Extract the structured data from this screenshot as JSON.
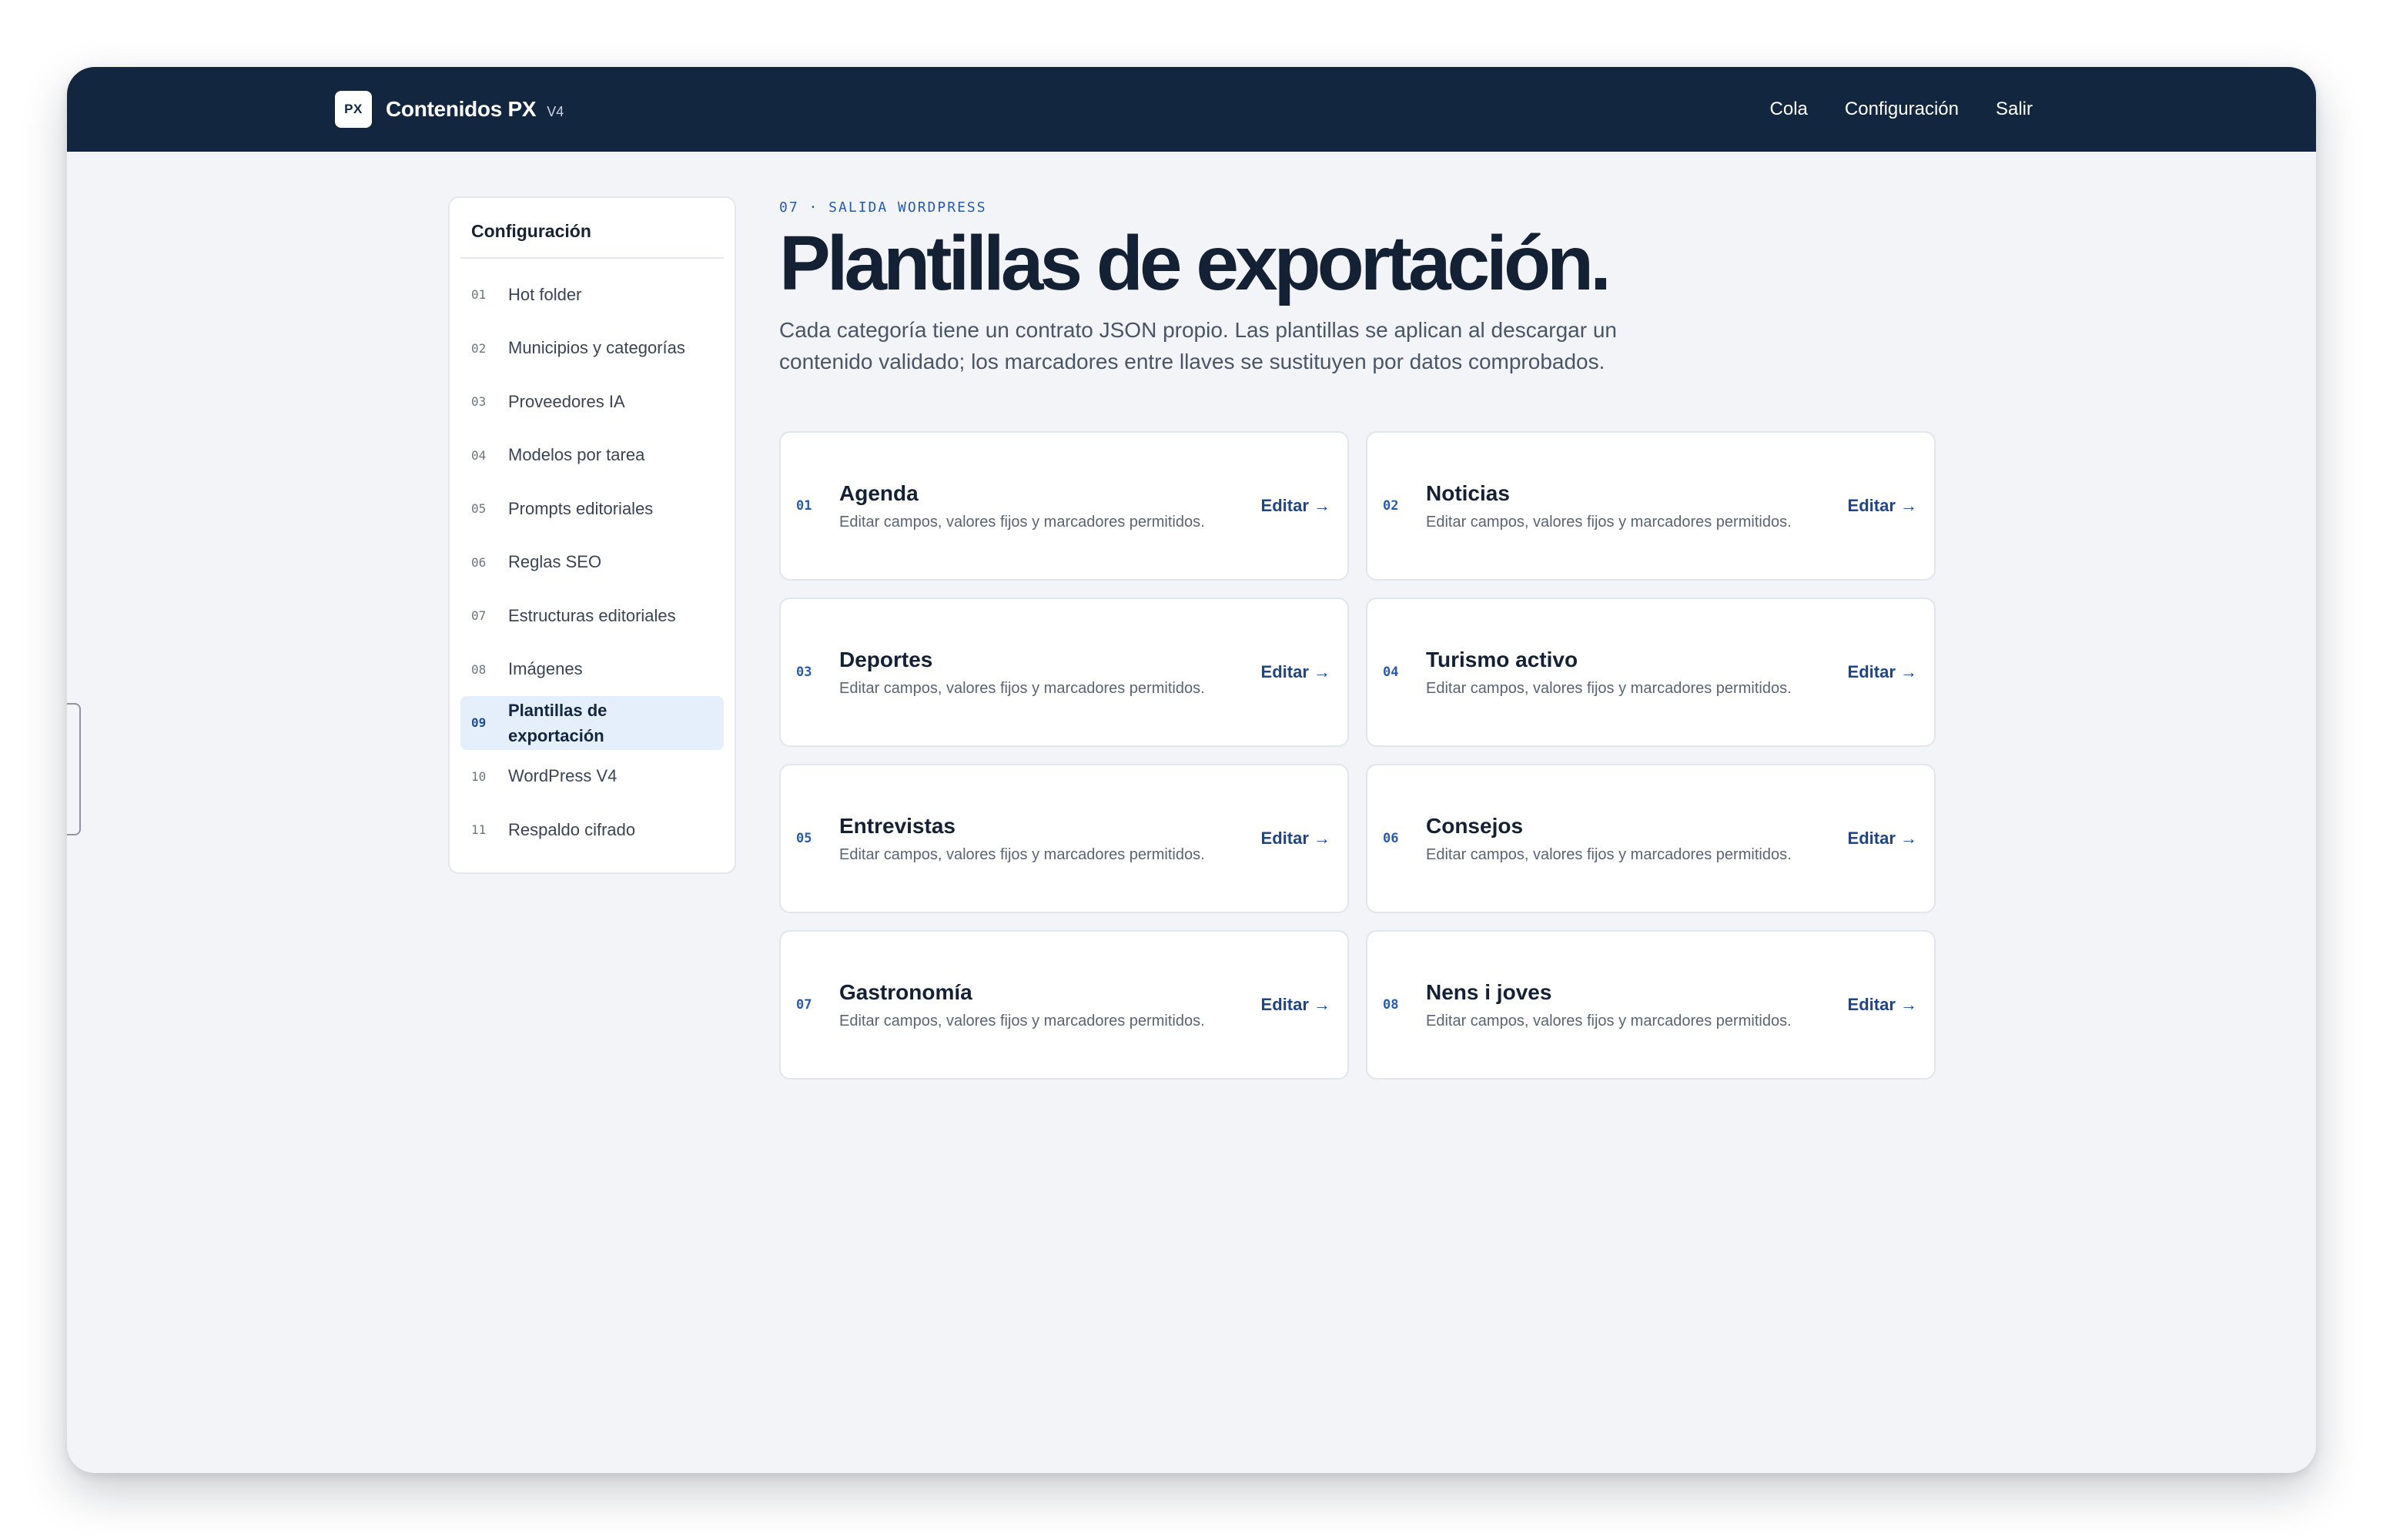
{
  "app": {
    "logo_text": "PX",
    "name": "Contenidos PX",
    "version": "V4"
  },
  "topnav": [
    {
      "label": "Cola"
    },
    {
      "label": "Configuración"
    },
    {
      "label": "Salir"
    }
  ],
  "sidebar": {
    "title": "Configuración",
    "active_index": 8,
    "items": [
      {
        "num": "01",
        "label": "Hot folder"
      },
      {
        "num": "02",
        "label": "Municipios y categorías"
      },
      {
        "num": "03",
        "label": "Proveedores IA"
      },
      {
        "num": "04",
        "label": "Modelos por tarea"
      },
      {
        "num": "05",
        "label": "Prompts editoriales"
      },
      {
        "num": "06",
        "label": "Reglas SEO"
      },
      {
        "num": "07",
        "label": "Estructuras editoriales"
      },
      {
        "num": "08",
        "label": "Imágenes"
      },
      {
        "num": "09",
        "label": "Plantillas de exportación"
      },
      {
        "num": "10",
        "label": "WordPress V4"
      },
      {
        "num": "11",
        "label": "Respaldo cifrado"
      }
    ]
  },
  "header": {
    "eyebrow": "07 · SALIDA WORDPRESS",
    "title": "Plantillas de exportación.",
    "description": "Cada categoría tiene un contrato JSON propio. Las plantillas se aplican al descargar un contenido validado; los marcadores entre llaves se sustituyen por datos comprobados."
  },
  "cards": [
    {
      "num": "01",
      "title": "Agenda",
      "subtitle": "Editar campos, valores fijos y marcadores permitidos.",
      "action": "Editar →"
    },
    {
      "num": "02",
      "title": "Noticias",
      "subtitle": "Editar campos, valores fijos y marcadores permitidos.",
      "action": "Editar →"
    },
    {
      "num": "03",
      "title": "Deportes",
      "subtitle": "Editar campos, valores fijos y marcadores permitidos.",
      "action": "Editar →"
    },
    {
      "num": "04",
      "title": "Turismo activo",
      "subtitle": "Editar campos, valores fijos y marcadores permitidos.",
      "action": "Editar →"
    },
    {
      "num": "05",
      "title": "Entrevistas",
      "subtitle": "Editar campos, valores fijos y marcadores permitidos.",
      "action": "Editar →"
    },
    {
      "num": "06",
      "title": "Consejos",
      "subtitle": "Editar campos, valores fijos y marcadores permitidos.",
      "action": "Editar →"
    },
    {
      "num": "07",
      "title": "Gastronomía",
      "subtitle": "Editar campos, valores fijos y marcadores permitidos.",
      "action": "Editar →"
    },
    {
      "num": "08",
      "title": "Nens i joves",
      "subtitle": "Editar campos, valores fijos y marcadores permitidos.",
      "action": "Editar →"
    }
  ],
  "colors": {
    "topbar": "#132640",
    "accent": "#2a5aa8",
    "active_bg": "#e5eefb",
    "page_bg": "#f2f4f7"
  }
}
